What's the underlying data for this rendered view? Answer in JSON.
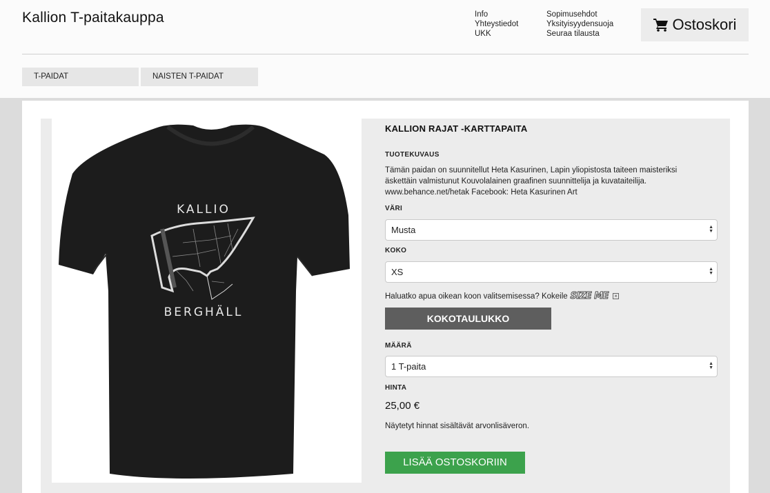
{
  "header": {
    "site_title": "Kallion T-paitakauppa",
    "links_col1": [
      "Info",
      "Yhteystiedot",
      "UKK"
    ],
    "links_col2": [
      "Sopimusehdot",
      "Yksityisyydensuoja",
      "Seuraa tilausta"
    ],
    "cart_label": "Ostoskori"
  },
  "categories": [
    "T-PAIDAT",
    "NAISTEN T-PAIDAT"
  ],
  "product": {
    "title": "KALLION RAJAT -KARTTAPAITA",
    "description_label": "TUOTEKUVAUS",
    "description": "Tämän paidan on suunnitellut Heta Kasurinen, Lapin yliopistosta taiteen maisteriksi äskettäin valmistunut Kouvolalainen graafinen suunnittelija ja kuvataiteilija. www.behance.net/hetak Facebook: Heta Kasurinen Art",
    "image_text_top": "KALLIO",
    "image_text_bottom": "BERGHÄLL",
    "color_label": "VÄRI",
    "color_value": "Musta",
    "size_label": "KOKO",
    "size_value": "XS",
    "size_help": "Haluatko apua oikean koon valitsemisessa? Kokeile",
    "sizeme_logo": "SIZE ME",
    "size_chart_button": "KOKOTAULUKKO",
    "quantity_label": "MÄÄRÄ",
    "quantity_value": "1 T-paita",
    "price_label": "HINTA",
    "price": "25,00 €",
    "vat_note": "Näytetyt hinnat sisältävät arvonlisäveron.",
    "add_to_cart": "LISÄÄ OSTOSKORIIN"
  },
  "colors": {
    "shirt": "#1c1c1c",
    "size_chart_button": "#5e5e5e",
    "add_to_cart_button": "#3ca24c",
    "page_background": "#dcdcdc"
  }
}
